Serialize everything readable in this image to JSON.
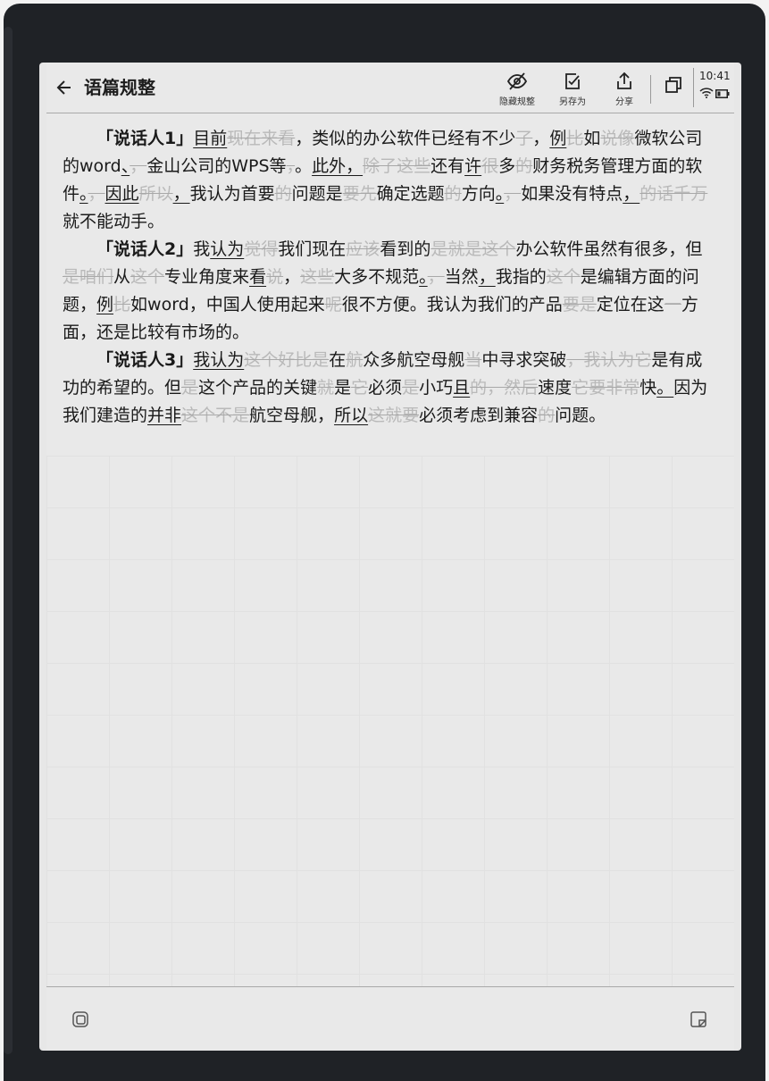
{
  "header": {
    "title": "语篇规整",
    "tools": [
      {
        "label": "隐藏规整",
        "icon": "eye-off-icon"
      },
      {
        "label": "另存为",
        "icon": "save-as-icon"
      },
      {
        "label": "分享",
        "icon": "share-icon"
      }
    ],
    "window_icon": "window-icon",
    "time": "10:41"
  },
  "paragraphs": [
    {
      "speaker": "「说话人1」",
      "runs": [
        {
          "t": "目前",
          "s": "u"
        },
        {
          "t": "现在来看",
          "s": "ghost"
        },
        {
          "t": "，类似的办公软件已经有不少",
          "s": ""
        },
        {
          "t": "了",
          "s": "ghost"
        },
        {
          "t": "，",
          "s": ""
        },
        {
          "t": "例",
          "s": "u"
        },
        {
          "t": "比",
          "s": "ghost"
        },
        {
          "t": "如",
          "s": ""
        },
        {
          "t": "说像",
          "s": "ghost"
        },
        {
          "t": "微软公司的word",
          "s": ""
        },
        {
          "t": "、",
          "s": "mark"
        },
        {
          "t": "，",
          "s": "ghost"
        },
        {
          "t": "金山公司的WPS等",
          "s": ""
        },
        {
          "t": "，",
          "s": "ghost"
        },
        {
          "t": "。",
          "s": ""
        },
        {
          "t": "此外，",
          "s": "u"
        },
        {
          "t": "除了这些",
          "s": "ghost"
        },
        {
          "t": "还有",
          "s": ""
        },
        {
          "t": "许",
          "s": "u"
        },
        {
          "t": "很",
          "s": "ghost"
        },
        {
          "t": "多",
          "s": ""
        },
        {
          "t": "的",
          "s": "ghost"
        },
        {
          "t": "财务税务管理方面的软件",
          "s": ""
        },
        {
          "t": "。",
          "s": "mark"
        },
        {
          "t": "，",
          "s": "ghost"
        },
        {
          "t": "因此",
          "s": "u"
        },
        {
          "t": "所以",
          "s": "ghost"
        },
        {
          "t": "，",
          "s": "u"
        },
        {
          "t": "我认为首要",
          "s": ""
        },
        {
          "t": "的",
          "s": "ghost"
        },
        {
          "t": "问题是",
          "s": ""
        },
        {
          "t": "要先",
          "s": "ghost"
        },
        {
          "t": "确定选题",
          "s": ""
        },
        {
          "t": "的",
          "s": "ghost"
        },
        {
          "t": "方向",
          "s": ""
        },
        {
          "t": "。",
          "s": "mark"
        },
        {
          "t": "，",
          "s": "ghost"
        },
        {
          "t": "如果没有特点",
          "s": ""
        },
        {
          "t": "，",
          "s": "mark"
        },
        {
          "t": "的话千万",
          "s": "ghost"
        },
        {
          "t": "就",
          "s": ""
        },
        {
          "t": "不能动手。",
          "s": ""
        }
      ]
    },
    {
      "speaker": "「说话人2」",
      "runs": [
        {
          "t": "我",
          "s": ""
        },
        {
          "t": "认为",
          "s": "u"
        },
        {
          "t": "觉得",
          "s": "ghost"
        },
        {
          "t": "我们现在",
          "s": ""
        },
        {
          "t": "应该",
          "s": "ghost"
        },
        {
          "t": "看到的",
          "s": ""
        },
        {
          "t": "是就是这个",
          "s": "ghost"
        },
        {
          "t": "办公软件虽然有很多，但",
          "s": ""
        },
        {
          "t": "是咱们",
          "s": "ghost"
        },
        {
          "t": "从",
          "s": ""
        },
        {
          "t": "这个",
          "s": "ghost"
        },
        {
          "t": "专业角度来",
          "s": ""
        },
        {
          "t": "看",
          "s": "u"
        },
        {
          "t": "说",
          "s": "ghost"
        },
        {
          "t": "，",
          "s": ""
        },
        {
          "t": "这些",
          "s": "ghost"
        },
        {
          "t": "大多不规范",
          "s": ""
        },
        {
          "t": "。",
          "s": "mark"
        },
        {
          "t": "，",
          "s": "ghost"
        },
        {
          "t": "当然",
          "s": ""
        },
        {
          "t": "，",
          "s": "u"
        },
        {
          "t": "我指的",
          "s": ""
        },
        {
          "t": "这个",
          "s": "ghost"
        },
        {
          "t": "是编辑方面的问题，",
          "s": ""
        },
        {
          "t": "例",
          "s": "u"
        },
        {
          "t": "比",
          "s": "ghost"
        },
        {
          "t": "如word，中国人使用起来",
          "s": ""
        },
        {
          "t": "呢",
          "s": "ghost"
        },
        {
          "t": "很不方便。我认为我们的产品",
          "s": ""
        },
        {
          "t": "要是",
          "s": "ghost"
        },
        {
          "t": "定位在这",
          "s": ""
        },
        {
          "t": "一",
          "s": "ghost"
        },
        {
          "t": "方面，还是比较有市场的。",
          "s": ""
        }
      ]
    },
    {
      "speaker": "「说话人3」",
      "runs": [
        {
          "t": "我认为",
          "s": "u"
        },
        {
          "t": "这个好比是",
          "s": "ghost"
        },
        {
          "t": "在",
          "s": ""
        },
        {
          "t": "航",
          "s": "ghost"
        },
        {
          "t": "众多航空母舰",
          "s": ""
        },
        {
          "t": "当",
          "s": "ghost"
        },
        {
          "t": "中寻求突破",
          "s": ""
        },
        {
          "t": "，我认为它",
          "s": "ghost"
        },
        {
          "t": "是有成功的希望的。但",
          "s": ""
        },
        {
          "t": "是",
          "s": "ghost"
        },
        {
          "t": "这个产品的关键",
          "s": ""
        },
        {
          "t": "就",
          "s": "ghost"
        },
        {
          "t": "是",
          "s": ""
        },
        {
          "t": "它",
          "s": "ghost"
        },
        {
          "t": "必须",
          "s": ""
        },
        {
          "t": "是",
          "s": "ghost"
        },
        {
          "t": "小巧",
          "s": ""
        },
        {
          "t": "且",
          "s": "u"
        },
        {
          "t": "的，然后",
          "s": "ghost"
        },
        {
          "t": "速度",
          "s": ""
        },
        {
          "t": "它要非常",
          "s": "ghost"
        },
        {
          "t": "快",
          "s": ""
        },
        {
          "t": "。",
          "s": "mark"
        },
        {
          "t": "因为我们建造的",
          "s": ""
        },
        {
          "t": "并非",
          "s": "u"
        },
        {
          "t": "这个不是",
          "s": "ghost"
        },
        {
          "t": "航空母舰，",
          "s": ""
        },
        {
          "t": "所以",
          "s": "u"
        },
        {
          "t": "这就要",
          "s": "ghost"
        },
        {
          "t": "必须考虑到兼容",
          "s": ""
        },
        {
          "t": "的",
          "s": "ghost"
        },
        {
          "t": "问题。",
          "s": ""
        }
      ]
    }
  ],
  "footer": {
    "left_icon": "sticker-icon",
    "right_icon": "note-icon"
  }
}
